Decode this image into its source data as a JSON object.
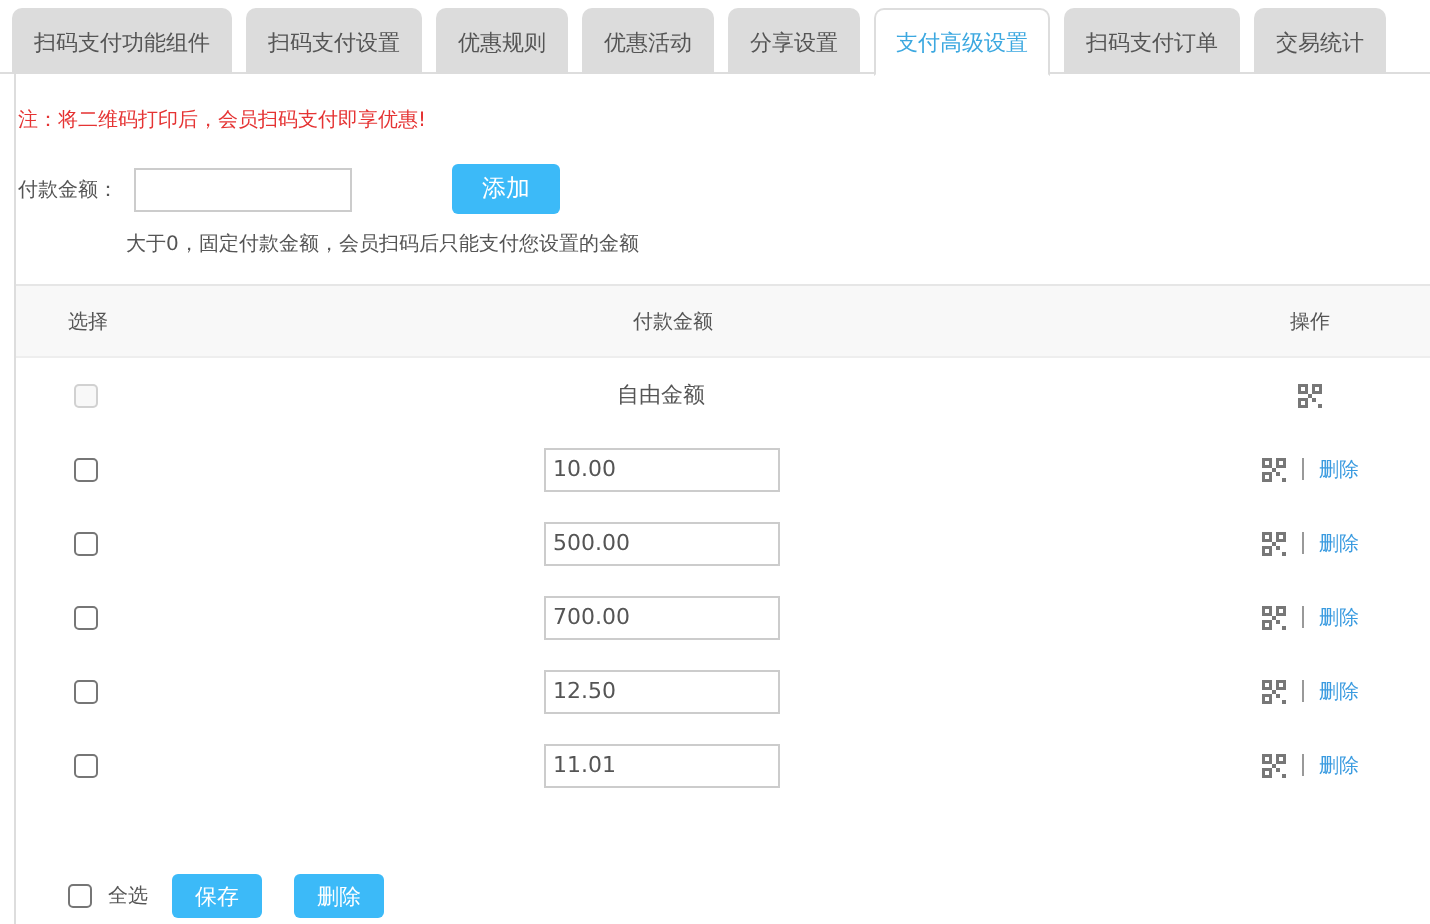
{
  "tabs": [
    {
      "label": "扫码支付功能组件",
      "selected": false
    },
    {
      "label": "扫码支付设置",
      "selected": false
    },
    {
      "label": "优惠规则",
      "selected": false
    },
    {
      "label": "优惠活动",
      "selected": false
    },
    {
      "label": "分享设置",
      "selected": false
    },
    {
      "label": "支付高级设置",
      "selected": true
    },
    {
      "label": "扫码支付订单",
      "selected": false
    },
    {
      "label": "交易统计",
      "selected": false
    }
  ],
  "notice": "注：将二维码打印后，会员扫码支付即享优惠!",
  "amount_form": {
    "label": "付款金额：",
    "add_button": "添加",
    "hint": "大于0，固定付款金额，会员扫码后只能支付您设置的金额"
  },
  "table": {
    "columns": [
      "选择",
      "付款金额",
      "操作"
    ],
    "rows": [
      {
        "kind": "free",
        "text": "自由金额",
        "checked": false,
        "disabled": true
      },
      {
        "kind": "fixed",
        "value": "10.00",
        "checked": false,
        "disabled": false,
        "action": "删除"
      },
      {
        "kind": "fixed",
        "value": "500.00",
        "checked": false,
        "disabled": false,
        "action": "删除"
      },
      {
        "kind": "fixed",
        "value": "700.00",
        "checked": false,
        "disabled": false,
        "action": "删除"
      },
      {
        "kind": "fixed",
        "value": "12.50",
        "checked": false,
        "disabled": false,
        "action": "删除"
      },
      {
        "kind": "fixed",
        "value": "11.01",
        "checked": false,
        "disabled": false,
        "action": "删除"
      }
    ]
  },
  "footer": {
    "select_all": {
      "label": "全选",
      "checked": false
    },
    "buttons": [
      "保存",
      "删除"
    ]
  }
}
